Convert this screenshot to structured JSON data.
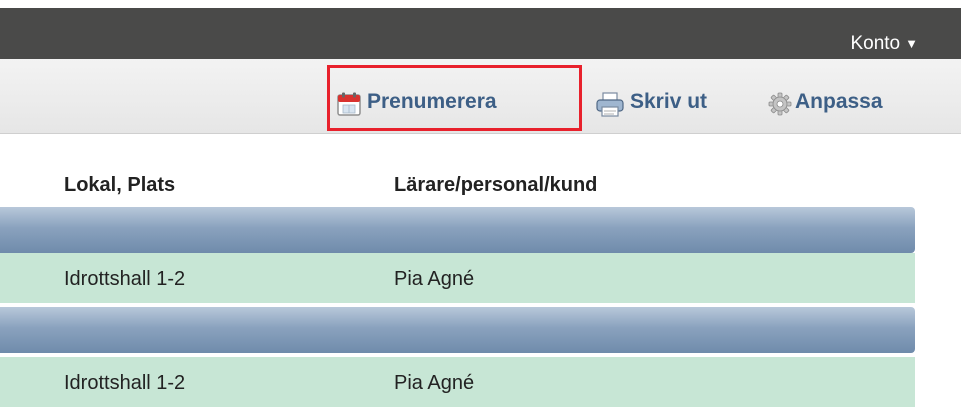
{
  "header": {
    "account_label": "Konto",
    "account_caret": "▼"
  },
  "toolbar": {
    "subscribe_label": "Prenumerera",
    "subscribe_icon": "calendar-icon",
    "print_label": "Skriv ut",
    "print_icon": "printer-icon",
    "customize_label": "Anpassa",
    "customize_icon": "gear-icon",
    "highlight_color": "#e8212c"
  },
  "table": {
    "columns": [
      "Lokal, Plats",
      "Lärare/personal/kund"
    ],
    "groups": [
      {
        "rows": [
          {
            "lokal": "Idrottshall 1-2",
            "larare": "Pia Agné"
          }
        ]
      },
      {
        "rows": [
          {
            "lokal": "Idrottshall 1-2",
            "larare": "Pia Agné"
          }
        ]
      }
    ]
  },
  "colors": {
    "topbar": "#4a4a49",
    "link": "#3d5f86",
    "group_row": "#8aa2be",
    "data_row": "#c7e6d5"
  }
}
